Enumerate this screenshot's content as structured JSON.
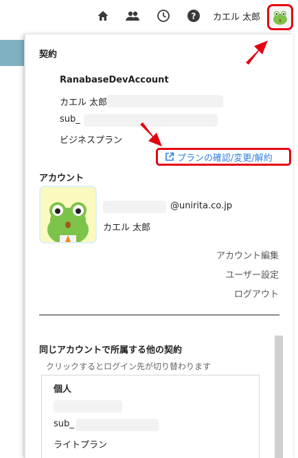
{
  "header": {
    "username": "カエル 太郎",
    "icons": [
      "home-icon",
      "group-icon",
      "clock-icon",
      "help-icon"
    ]
  },
  "contract": {
    "section_title": "契約",
    "account_name": "RanabaseDevAccount",
    "owner_name": "カエル 太郎",
    "sub_label": "sub_",
    "plan_name": "ビジネスプラン",
    "plan_link": "プランの確認/変更/解約"
  },
  "account": {
    "section_title": "アカウント",
    "email_domain": "@unirita.co.jp",
    "name": "カエル 太郎",
    "links": [
      "アカウント編集",
      "ユーザー設定",
      "ログアウト"
    ]
  },
  "other_contracts": {
    "section_title": "同じアカウントで所属する他の契約",
    "hint": "クリックするとログイン先が切り替わります",
    "item": {
      "title": "個人",
      "sub_label": "sub_",
      "plan_name": "ライトプラン"
    }
  },
  "colors": {
    "highlight": "#e50011",
    "link": "#2f7fe0",
    "avatar_bg": "#fafabe"
  }
}
